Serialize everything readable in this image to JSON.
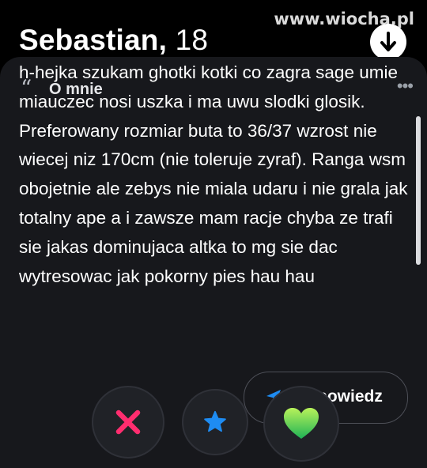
{
  "watermark": "www.wiocha.pl",
  "profile": {
    "name": "Sebastian,",
    "age": "18"
  },
  "bio_section": {
    "title": "O mnie",
    "text": "h-hejka szukam ghotki kotki co zagra sage umie miauczec nosi uszka i ma uwu slodki glosik. Preferowany rozmiar buta to 36/37 wzrost nie wiecej niz 170cm (nie toleruje zyraf). Ranga wsm obojetnie ale zebys nie miala udaru i nie grala jak totalny ape a i zawsze mam racje chyba ze trafi sie jakas dominujaca altka to mg sie dac wytresowac jak pokorny pies hau hau"
  },
  "reply_button": {
    "label": "powiedz"
  },
  "colors": {
    "nope": "#ff2d6f",
    "super_like": "#1e8cf2",
    "like_top": "#b8f25a",
    "like_bottom": "#1fb356"
  },
  "icons": [
    "arrow-down-icon",
    "quote-icon",
    "more-dots-icon",
    "send-icon",
    "x-icon",
    "star-icon",
    "heart-icon"
  ]
}
